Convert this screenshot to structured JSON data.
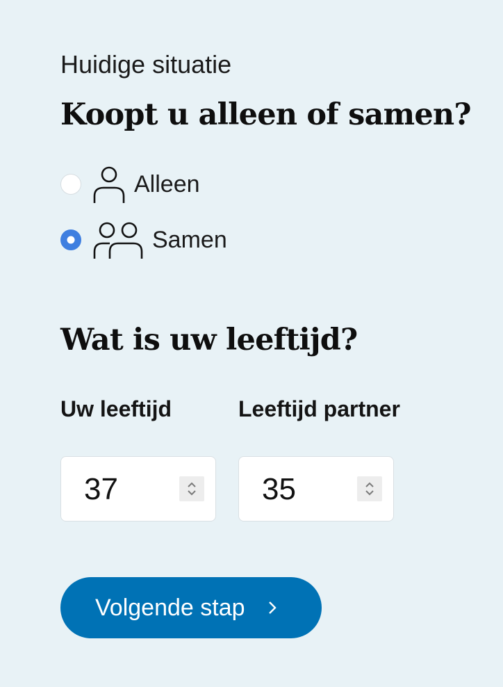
{
  "section": {
    "eyebrow": "Huidige situatie",
    "question_buying": "Koopt u alleen of samen?",
    "question_age": "Wat is uw leeftijd?"
  },
  "buying_options": [
    {
      "label": "Alleen",
      "icon": "person-icon",
      "selected": false
    },
    {
      "label": "Samen",
      "icon": "people-icon",
      "selected": true
    }
  ],
  "age_fields": {
    "own_label": "Uw leeftijd",
    "own_value": "37",
    "partner_label": "Leeftijd partner",
    "partner_value": "35"
  },
  "cta": {
    "label": "Volgende stap",
    "icon": "chevron-right-icon"
  },
  "colors": {
    "background": "#e8f2f6",
    "accent": "#3f7fe0",
    "button": "#0072b5"
  }
}
